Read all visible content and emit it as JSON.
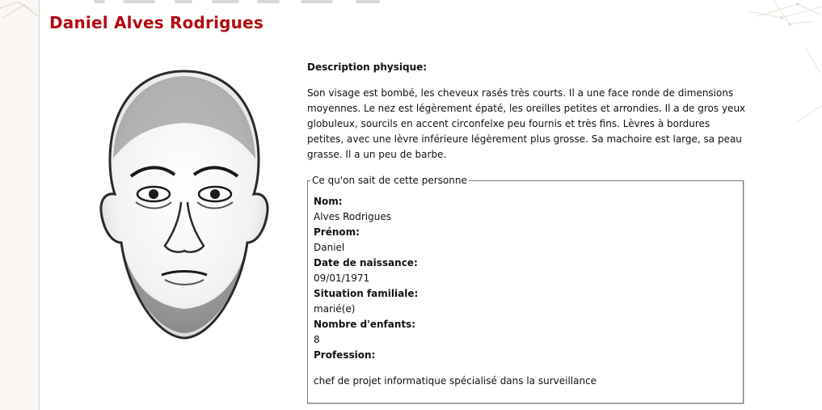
{
  "page": {
    "title": "Daniel Alves Rodrigues"
  },
  "portrait": {
    "kind": "police composite sketch",
    "icon": "portrait-sketch"
  },
  "description": {
    "heading": "Description physique:",
    "text": "Son visage est bombé, les cheveux rasés très courts. Il a une face ronde de dimensions moyennes. Le nez est légèrement épaté, les oreilles petites et arrondies. Il a de gros yeux globuleux, sourcils en accent circonfelxe peu fournis et très fins. Lèvres à bordures petites, avec une lèvre inférieure légèrement plus grosse. Sa machoire est large, sa peau grasse. Il a un peu de barbe."
  },
  "info": {
    "legend": "Ce qu'on sait de cette personne",
    "fields": [
      {
        "label": "Nom:",
        "value": "Alves Rodrigues"
      },
      {
        "label": "Prénom:",
        "value": "Daniel"
      },
      {
        "label": "Date de naissance:",
        "value": "09/01/1971"
      },
      {
        "label": "Situation familiale:",
        "value": "marié(e)"
      },
      {
        "label": "Nombre d'enfants:",
        "value": "8"
      },
      {
        "label": "Profession:",
        "value": ""
      }
    ],
    "profession": "chef de projet informatique spécialisé dans la surveillance"
  },
  "colors": {
    "title": "#b3090f",
    "text": "#111111",
    "border": "#7a7a7a"
  }
}
